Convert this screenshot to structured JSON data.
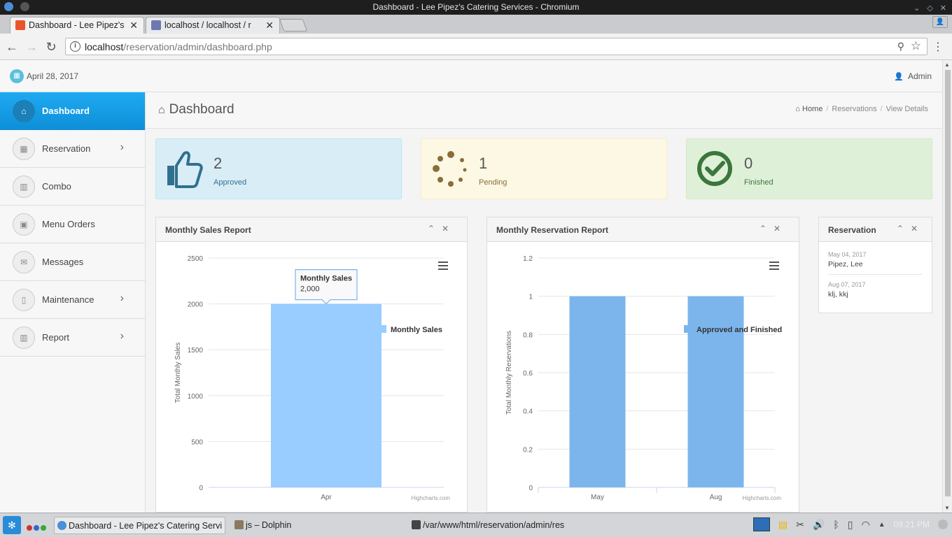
{
  "window": {
    "title": "Dashboard - Lee Pipez's Catering Services - Chromium"
  },
  "tabs": [
    {
      "label": "Dashboard - Lee Pipez's",
      "favicon_color": "#e8552a"
    },
    {
      "label": "localhost / localhost / r",
      "favicon_color": "#6c78af"
    }
  ],
  "browser": {
    "url_host": "localhost",
    "url_path": "/reservation/admin/dashboard.php",
    "profile_glyph": "👤"
  },
  "header": {
    "date": "April 28, 2017",
    "user": "Admin"
  },
  "sidebar": {
    "items": [
      {
        "label": "Dashboard",
        "icon": "home-icon",
        "glyph": "⌂",
        "active": true,
        "has_sub": false
      },
      {
        "label": "Reservation",
        "icon": "calendar-icon",
        "glyph": "▦",
        "active": false,
        "has_sub": true
      },
      {
        "label": "Combo",
        "icon": "bar-chart-icon",
        "glyph": "▥",
        "active": false,
        "has_sub": false
      },
      {
        "label": "Menu Orders",
        "icon": "money-icon",
        "glyph": "▣",
        "active": false,
        "has_sub": false
      },
      {
        "label": "Messages",
        "icon": "envelope-icon",
        "glyph": "✉",
        "active": false,
        "has_sub": false
      },
      {
        "label": "Maintenance",
        "icon": "file-icon",
        "glyph": "▯",
        "active": false,
        "has_sub": true
      },
      {
        "label": "Report",
        "icon": "bar-chart-icon",
        "glyph": "▥",
        "active": false,
        "has_sub": true
      }
    ]
  },
  "page": {
    "title": "Dashboard",
    "breadcrumb": [
      "Home",
      "Reservations",
      "View Details"
    ]
  },
  "stats": [
    {
      "value": "2",
      "label": "Approved",
      "bg": "#d9edf7",
      "border": "#bce8f1",
      "color": "#31708f"
    },
    {
      "value": "1",
      "label": "Pending",
      "bg": "#fcf8e3",
      "border": "#faebcc",
      "color": "#8a6d3b"
    },
    {
      "value": "0",
      "label": "Finished",
      "bg": "#dff0d8",
      "border": "#d6e9c6",
      "color": "#3c763d"
    }
  ],
  "panels": {
    "sales": {
      "title": "Monthly Sales Report"
    },
    "reservations": {
      "title": "Monthly Reservation Report"
    },
    "recent": {
      "title": "Reservation"
    }
  },
  "recent_reservations": [
    {
      "date": "May 04, 2017",
      "name": "Pipez, Lee"
    },
    {
      "date": "Aug 07, 2017",
      "name": "klj, kkj"
    }
  ],
  "chart_data": [
    {
      "type": "bar",
      "categories": [
        "Apr"
      ],
      "series": [
        {
          "name": "Monthly Sales",
          "values": [
            2000
          ],
          "color": "#99ccff"
        }
      ],
      "title": "",
      "xlabel": "",
      "ylabel": "Total Monthly Sales",
      "ylim": [
        0,
        2500
      ],
      "yticks": [
        "0",
        "500",
        "1000",
        "1500",
        "2000",
        "2500"
      ],
      "legend": "right",
      "grid": true,
      "credits": "Highcharts.com",
      "tooltip": {
        "title": "Monthly Sales",
        "value": "2,000"
      }
    },
    {
      "type": "bar",
      "categories": [
        "May",
        "Aug"
      ],
      "series": [
        {
          "name": "Approved and Finished",
          "values": [
            1,
            1
          ],
          "color": "#7cb5ec"
        }
      ],
      "title": "",
      "xlabel": "",
      "ylabel": "Total Monthly Reservations",
      "ylim": [
        0,
        1.2
      ],
      "yticks": [
        "0",
        "0.2",
        "0.4",
        "0.6",
        "0.8",
        "1",
        "1.2"
      ],
      "legend": "right",
      "grid": true,
      "credits": "Highcharts.com"
    }
  ],
  "taskbar": {
    "tasks": [
      {
        "label": "Dashboard - Lee Pipez's Catering Servi",
        "active": true
      },
      {
        "label": "js – Dolphin",
        "active": false
      },
      {
        "label": "/var/www/html/reservation/admin/res",
        "active": false
      }
    ],
    "clock": "09:21 PM"
  }
}
